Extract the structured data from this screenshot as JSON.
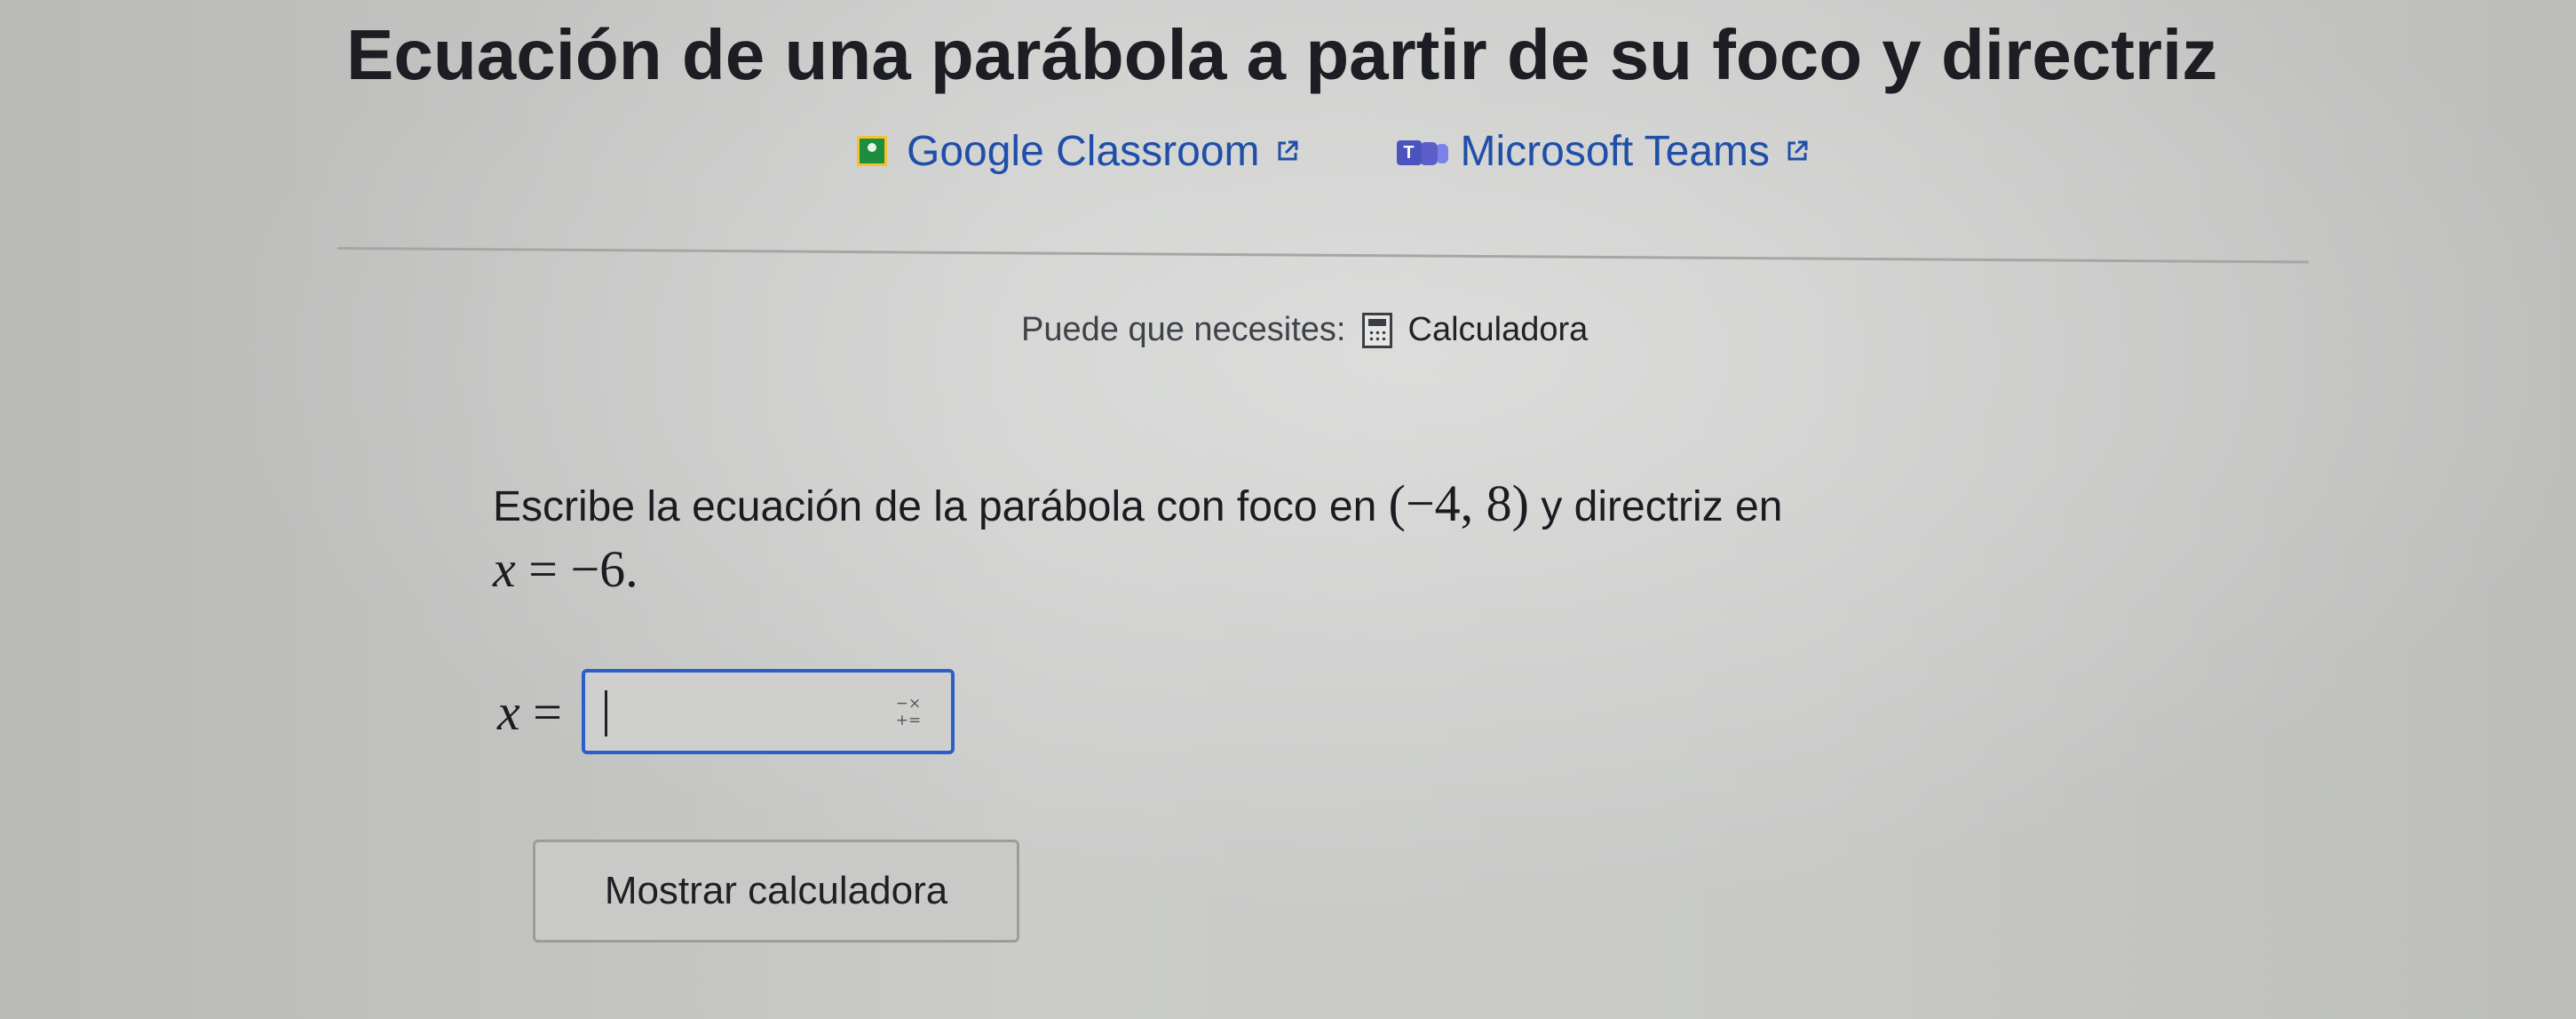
{
  "page": {
    "title": "Ecuación de una parábola a partir de su foco y directriz"
  },
  "share": {
    "google_classroom": "Google Classroom",
    "microsoft_teams": "Microsoft Teams"
  },
  "tools": {
    "label": "Puede que necesites:",
    "calculator": "Calculadora"
  },
  "question": {
    "text_before": "Escribe la ecuación de la parábola con foco en ",
    "focus": "(−4, 8)",
    "text_middle": " y directriz en",
    "directrix": "x = −6.",
    "directrix_var": "x",
    "directrix_rest": " = −6."
  },
  "answer": {
    "lhs": "x =",
    "lhs_var": "x",
    "lhs_eq": " =",
    "value": "",
    "keyboard_icon_top": "−×",
    "keyboard_icon_bottom": "+="
  },
  "buttons": {
    "show_calculator": "Mostrar calculadora"
  },
  "icons": {
    "google_classroom": "google-classroom-icon",
    "microsoft_teams": "microsoft-teams-icon",
    "external_link": "external-link-icon",
    "calculator": "calculator-icon",
    "math_keyboard": "math-keyboard-icon"
  }
}
